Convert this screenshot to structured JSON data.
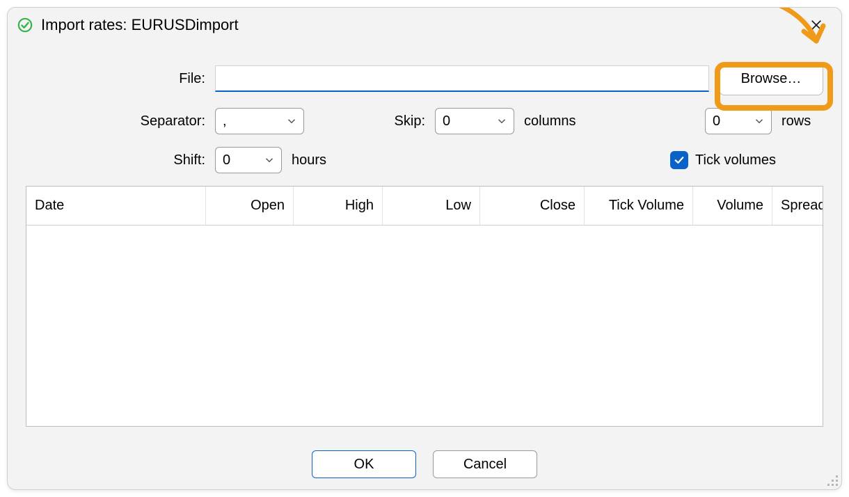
{
  "window": {
    "title": "Import rates: EURUSDimport"
  },
  "form": {
    "file_label": "File:",
    "file_value": "",
    "browse_label": "Browse…",
    "separator_label": "Separator:",
    "separator_value": ",",
    "skip_label": "Skip:",
    "skip_columns_value": "0",
    "skip_columns_unit": "columns",
    "skip_rows_value": "0",
    "skip_rows_unit": "rows",
    "shift_label": "Shift:",
    "shift_value": "0",
    "shift_unit": "hours",
    "tick_volumes_label": "Tick volumes",
    "tick_volumes_checked": true
  },
  "table": {
    "columns": [
      "Date",
      "Open",
      "High",
      "Low",
      "Close",
      "Tick Volume",
      "Volume",
      "Spread"
    ],
    "rows": []
  },
  "footer": {
    "ok_label": "OK",
    "cancel_label": "Cancel"
  },
  "colors": {
    "accent": "#0a62c9",
    "highlight": "#f09a1a"
  }
}
